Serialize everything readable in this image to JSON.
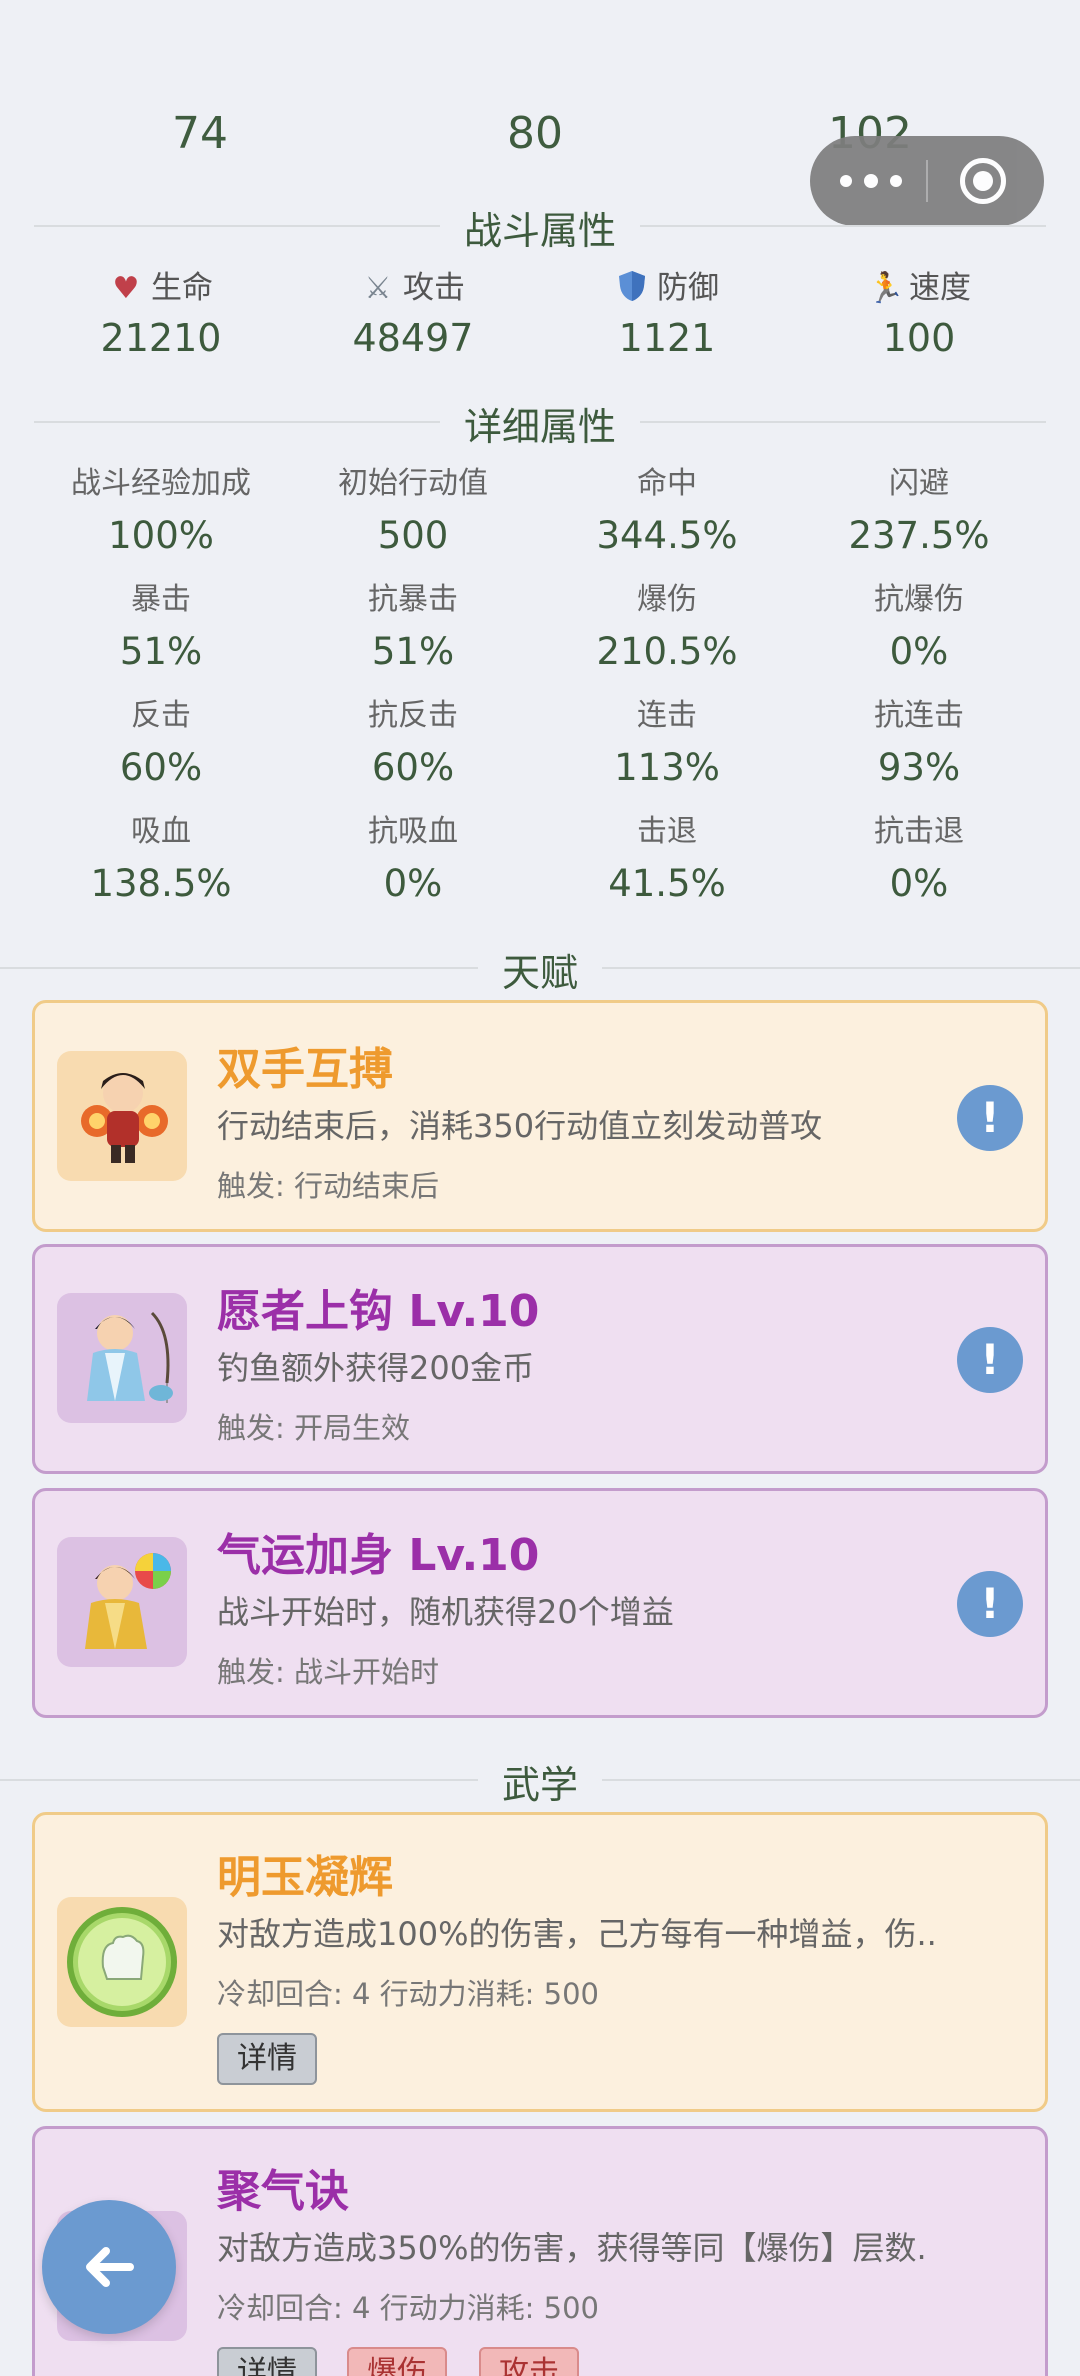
{
  "top_values": [
    "74",
    "80",
    "102"
  ],
  "sections": {
    "battle": "战斗属性",
    "detail": "详细属性",
    "talent": "天赋",
    "martial": "武学"
  },
  "battle_stats": [
    {
      "label": "生命",
      "value": "21210",
      "icon": "heart-icon"
    },
    {
      "label": "攻击",
      "value": "48497",
      "icon": "swords-icon"
    },
    {
      "label": "防御",
      "value": "1121",
      "icon": "shield-icon"
    },
    {
      "label": "速度",
      "value": "100",
      "icon": "runner-icon"
    }
  ],
  "detail_stats": [
    {
      "label": "战斗经验加成",
      "value": "100%"
    },
    {
      "label": "初始行动值",
      "value": "500"
    },
    {
      "label": "命中",
      "value": "344.5%"
    },
    {
      "label": "闪避",
      "value": "237.5%"
    },
    {
      "label": "暴击",
      "value": "51%"
    },
    {
      "label": "抗暴击",
      "value": "51%"
    },
    {
      "label": "爆伤",
      "value": "210.5%"
    },
    {
      "label": "抗爆伤",
      "value": "0%"
    },
    {
      "label": "反击",
      "value": "60%"
    },
    {
      "label": "抗反击",
      "value": "60%"
    },
    {
      "label": "连击",
      "value": "113%"
    },
    {
      "label": "抗连击",
      "value": "93%"
    },
    {
      "label": "吸血",
      "value": "138.5%"
    },
    {
      "label": "抗吸血",
      "value": "0%"
    },
    {
      "label": "击退",
      "value": "41.5%"
    },
    {
      "label": "抗击退",
      "value": "0%"
    }
  ],
  "talents": [
    {
      "title": "双手互搏",
      "desc": "行动结束后，消耗350行动值立刻发动普攻",
      "trigger": "触发: 行动结束后",
      "info": "!"
    },
    {
      "title": "愿者上钩  Lv.10",
      "desc": "钓鱼额外获得200金币",
      "trigger": "触发: 开局生效",
      "info": "!"
    },
    {
      "title": "气运加身  Lv.10",
      "desc": "战斗开始时，随机获得20个增益",
      "trigger": "触发: 战斗开始时",
      "info": "!"
    }
  ],
  "martial_arts": [
    {
      "title": "明玉凝辉",
      "desc": "对敌方造成100%的伤害，己方每有一种增益，伤..",
      "meta": "冷却回合: 4  行动力消耗: 500",
      "tags": [
        "详情"
      ]
    },
    {
      "title": "聚气诀",
      "desc": "对敌方造成350%的伤害，获得等同【爆伤】层数.",
      "meta": "冷却回合: 4  行动力消耗: 500",
      "tags": [
        "详情",
        "爆伤",
        "攻击"
      ]
    }
  ],
  "colors": {
    "accent_blue": "#6b9ad0",
    "orange_title": "#ee9a2e",
    "purple_title": "#9b2fa8",
    "stat_green": "#3d5a3d"
  }
}
